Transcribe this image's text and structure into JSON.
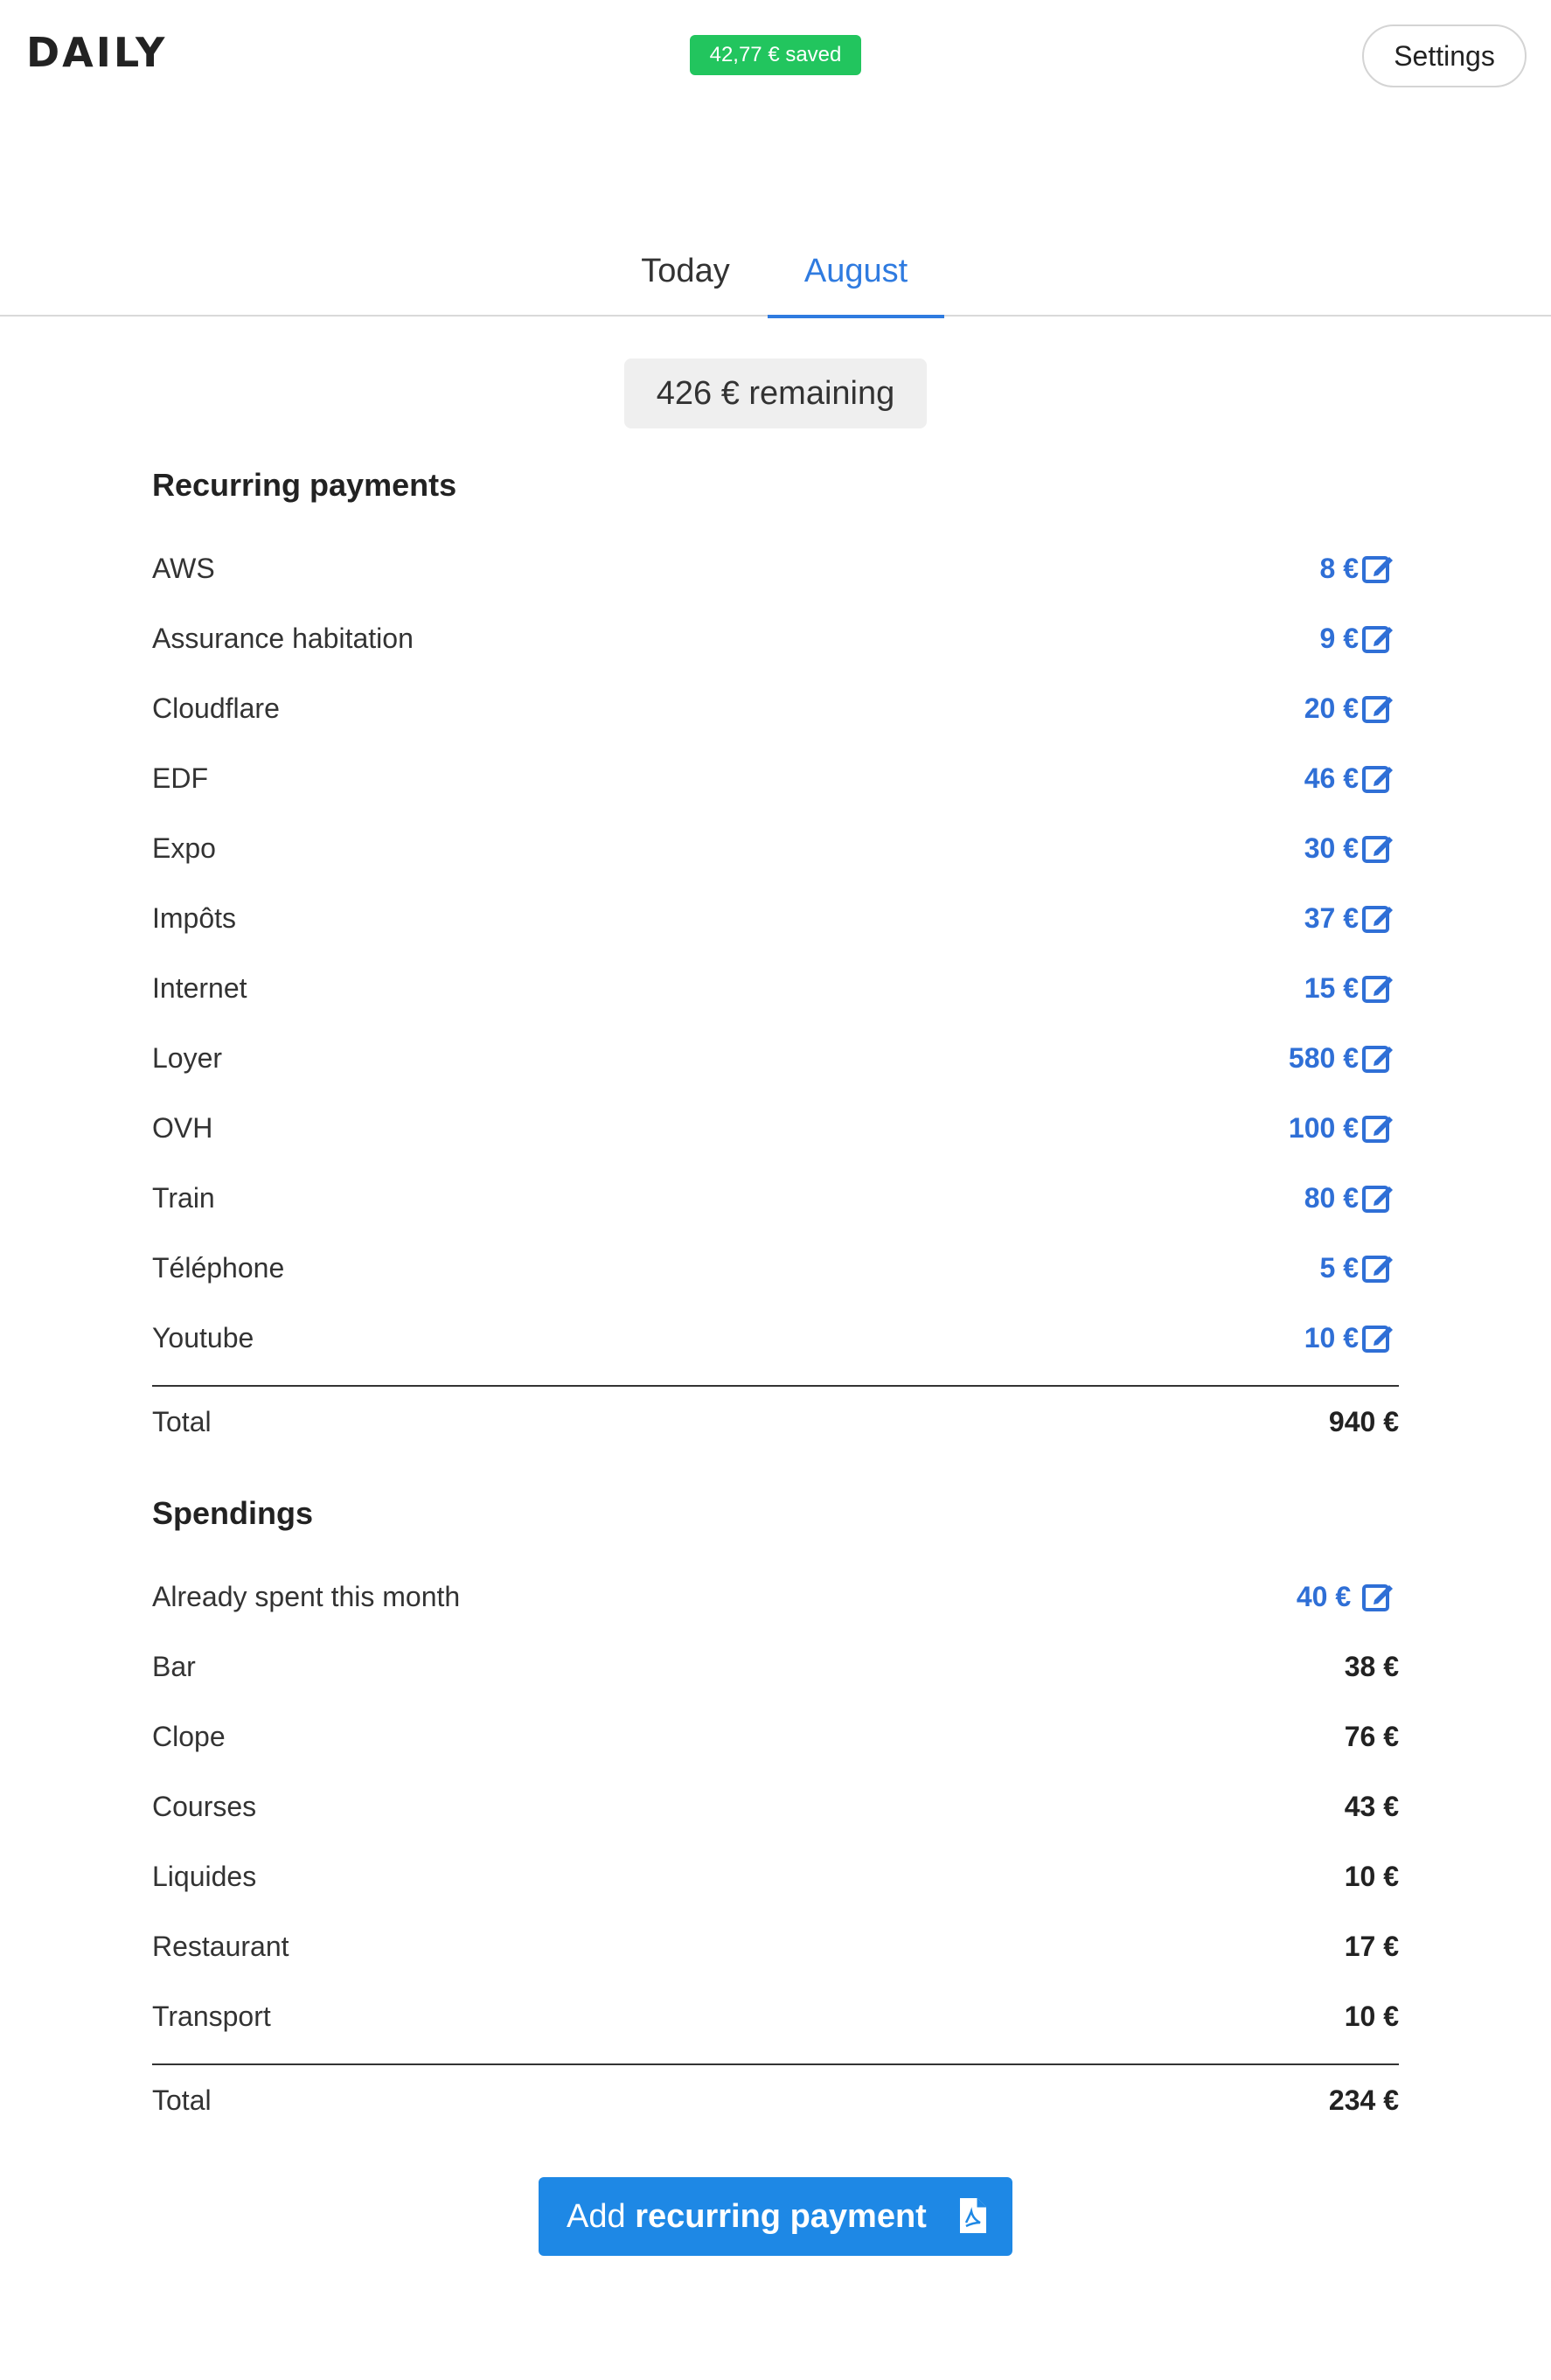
{
  "header": {
    "logo": "DAILY",
    "saved_badge": "42,77 € saved",
    "settings_label": "Settings"
  },
  "tabs": [
    {
      "label": "Today",
      "active": false
    },
    {
      "label": "August",
      "active": true
    }
  ],
  "remaining": "426 € remaining",
  "recurring": {
    "title": "Recurring payments",
    "items": [
      {
        "label": "AWS",
        "amount": "8 €"
      },
      {
        "label": "Assurance habitation",
        "amount": "9 €"
      },
      {
        "label": "Cloudflare",
        "amount": "20 €"
      },
      {
        "label": "EDF",
        "amount": "46 €"
      },
      {
        "label": "Expo",
        "amount": "30 €"
      },
      {
        "label": "Impôts",
        "amount": "37 €"
      },
      {
        "label": "Internet",
        "amount": "15 €"
      },
      {
        "label": "Loyer",
        "amount": "580 €"
      },
      {
        "label": "OVH",
        "amount": "100 €"
      },
      {
        "label": "Train",
        "amount": "80 €"
      },
      {
        "label": "Téléphone",
        "amount": "5 €"
      },
      {
        "label": "Youtube",
        "amount": "10 €"
      }
    ],
    "total_label": "Total",
    "total_amount": "940 €"
  },
  "spendings": {
    "title": "Spendings",
    "already_spent": {
      "label": "Already spent this month",
      "amount": "40 €"
    },
    "items": [
      {
        "label": "Bar",
        "amount": "38 €"
      },
      {
        "label": "Clope",
        "amount": "76 €"
      },
      {
        "label": "Courses",
        "amount": "43 €"
      },
      {
        "label": "Liquides",
        "amount": "10 €"
      },
      {
        "label": "Restaurant",
        "amount": "17 €"
      },
      {
        "label": "Transport",
        "amount": "10 €"
      }
    ],
    "total_label": "Total",
    "total_amount": "234 €"
  },
  "add_button": {
    "prefix": "Add",
    "strong": "recurring payment",
    "icon": "document-icon"
  },
  "colors": {
    "accent": "#2f7be0",
    "saved_badge": "#22c55e",
    "button": "#1e88e5"
  }
}
